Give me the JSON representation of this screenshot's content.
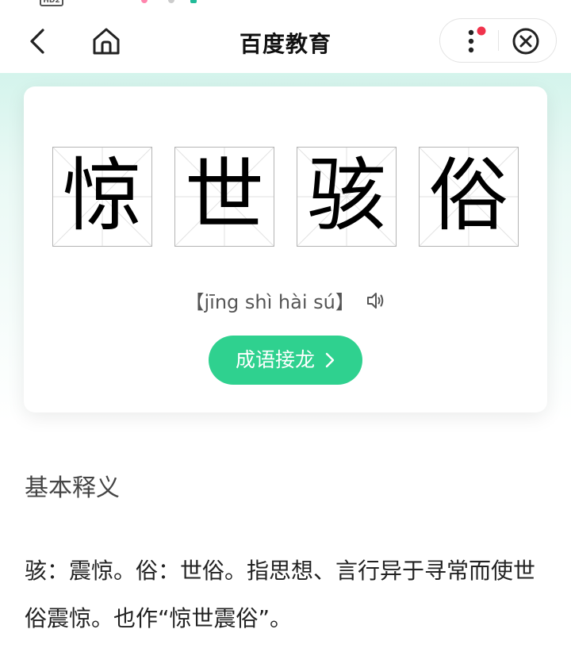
{
  "status_bar": {
    "badge": "HD2"
  },
  "header": {
    "title": "百度教育"
  },
  "idiom": {
    "characters": [
      "惊",
      "世",
      "骇",
      "俗"
    ],
    "pinyin": "【jīng shì hài sú】",
    "chain_button_label": "成语接龙"
  },
  "section": {
    "heading": "基本释义",
    "definition": "骇：震惊。俗：世俗。指思想、言行异于寻常而使世俗震惊。也作“惊世震俗”。"
  },
  "colors": {
    "accent_green": "#2fd18f",
    "band_top": "#d4f4ec",
    "notification_dot": "#f0334c"
  }
}
